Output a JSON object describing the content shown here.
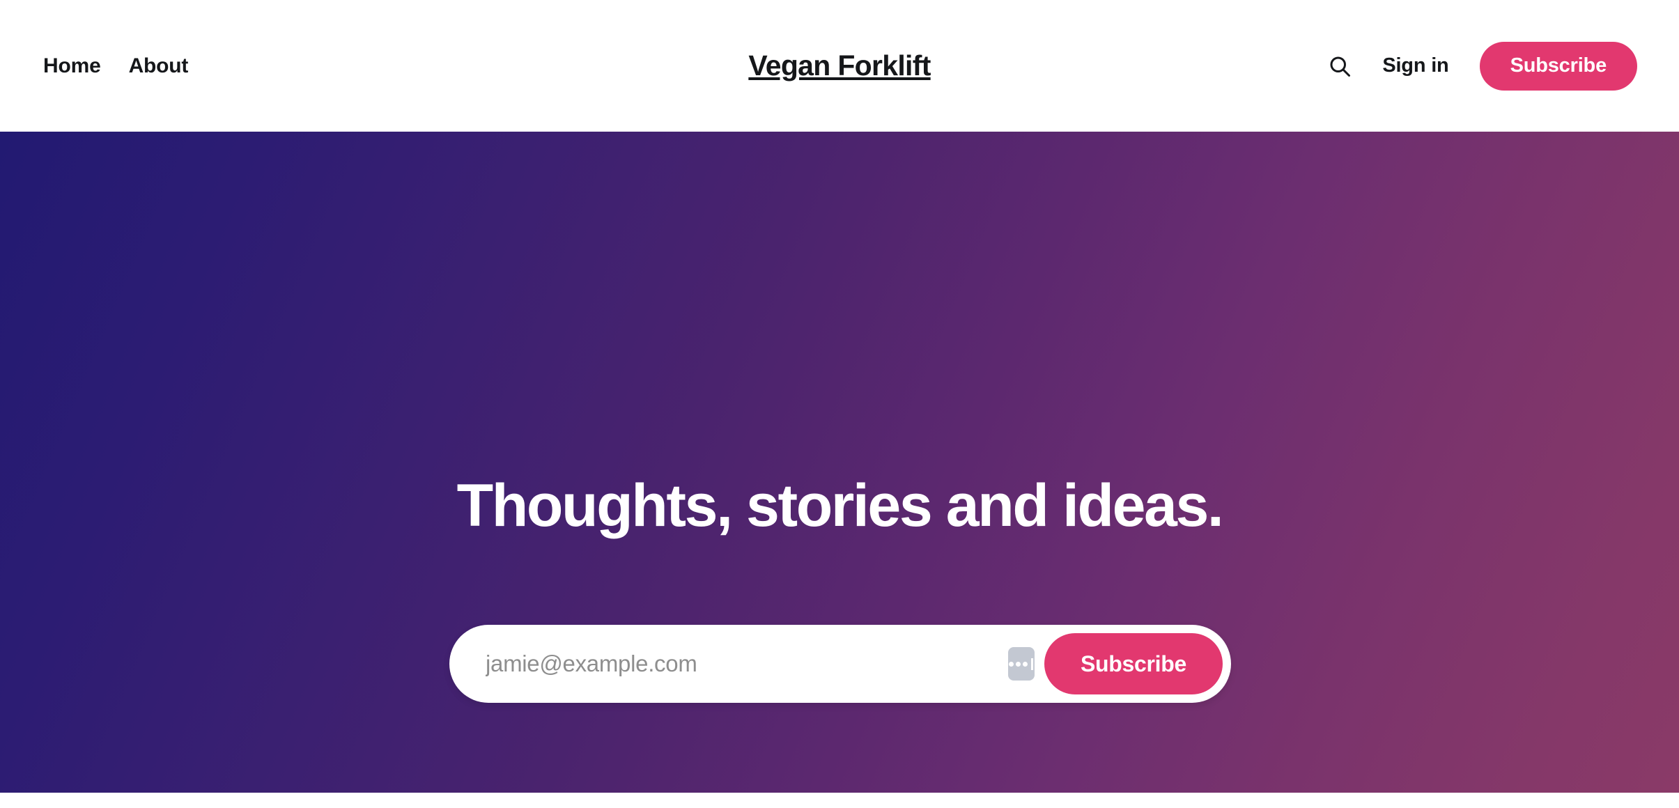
{
  "header": {
    "nav": [
      {
        "label": "Home"
      },
      {
        "label": "About"
      }
    ],
    "site_title": "Vegan Forklift",
    "search_icon": "search-icon",
    "signin_label": "Sign in",
    "subscribe_label": "Subscribe"
  },
  "hero": {
    "title": "Thoughts, stories and ideas.",
    "form": {
      "email_placeholder": "jamie@example.com",
      "email_value": "",
      "autofill_icon": "password-autofill-icon",
      "subscribe_label": "Subscribe"
    }
  },
  "colors": {
    "accent_pink": "#e2386f",
    "text_dark": "#15171a",
    "hero_gradient_start": "#221a72",
    "hero_gradient_end": "#8a3a68",
    "placeholder_gray": "#8e8e8e",
    "header_background": "#ffffff"
  }
}
